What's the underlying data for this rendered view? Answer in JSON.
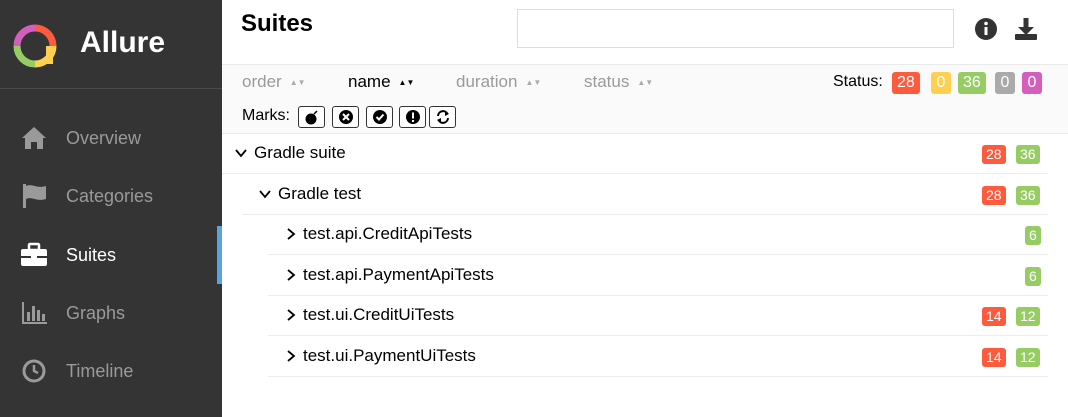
{
  "brand": {
    "name": "Allure"
  },
  "nav": [
    {
      "key": "overview",
      "label": "Overview",
      "icon": "home-icon"
    },
    {
      "key": "categories",
      "label": "Categories",
      "icon": "flag-icon"
    },
    {
      "key": "suites",
      "label": "Suites",
      "icon": "briefcase-icon",
      "active": true
    },
    {
      "key": "graphs",
      "label": "Graphs",
      "icon": "bar-chart-icon"
    },
    {
      "key": "timeline",
      "label": "Timeline",
      "icon": "clock-icon"
    }
  ],
  "header": {
    "title": "Suites",
    "search_value": ""
  },
  "sorters": [
    {
      "label": "order"
    },
    {
      "label": "name",
      "active": true
    },
    {
      "label": "duration"
    },
    {
      "label": "status"
    }
  ],
  "status_filter": {
    "label": "Status:",
    "counts": [
      {
        "name": "failed",
        "value": "28",
        "color": "#fd5a3e"
      },
      {
        "name": "broken",
        "value": "0",
        "color": "#ffd050"
      },
      {
        "name": "passed",
        "value": "36",
        "color": "#97cc64"
      },
      {
        "name": "skipped",
        "value": "0",
        "color": "#aaaaaa"
      },
      {
        "name": "unknown",
        "value": "0",
        "color": "#d35ebe"
      }
    ]
  },
  "marks": {
    "label": "Marks:",
    "items": [
      "bomb-icon",
      "close-circle-icon",
      "check-circle-icon",
      "exclamation-circle-icon",
      "refresh-icon"
    ]
  },
  "tree": [
    {
      "name": "Gradle suite",
      "expanded": true,
      "level": 0,
      "failed": "28",
      "passed": "36"
    },
    {
      "name": "Gradle test",
      "expanded": true,
      "level": 1,
      "failed": "28",
      "passed": "36"
    },
    {
      "name": "test.api.CreditApiTests",
      "expanded": false,
      "level": 2,
      "failed": "",
      "passed": "6"
    },
    {
      "name": "test.api.PaymentApiTests",
      "expanded": false,
      "level": 2,
      "failed": "",
      "passed": "6"
    },
    {
      "name": "test.ui.CreditUiTests",
      "expanded": false,
      "level": 2,
      "failed": "14",
      "passed": "12"
    },
    {
      "name": "test.ui.PaymentUiTests",
      "expanded": false,
      "level": 2,
      "failed": "14",
      "passed": "12"
    }
  ],
  "colors": {
    "failed": "#fd5a3e",
    "passed": "#97cc64",
    "sidebar": "#343434",
    "accent": "#5ba3e0"
  }
}
